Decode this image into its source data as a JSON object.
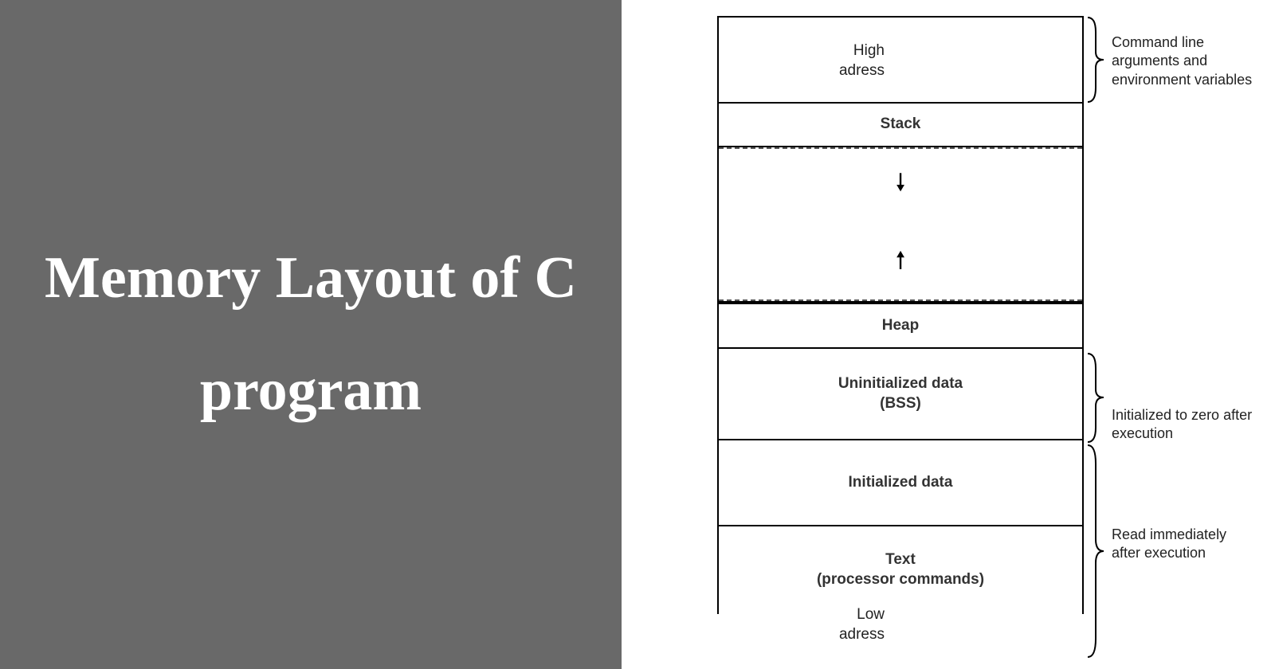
{
  "title": "Memory Layout of C program",
  "left_labels": {
    "high": "High\nadress",
    "low": "Low\nadress"
  },
  "segments": {
    "cmdline": "",
    "stack": "Stack",
    "heap": "Heap",
    "bss_line1": "Uninitialized data",
    "bss_line2": "(BSS)",
    "init": "Initialized data",
    "text_line1": "Text",
    "text_line2": "(processor commands)"
  },
  "annotations": {
    "cmdline": "Command line arguments and environment variables",
    "bss": "Initialized to zero after execution",
    "init_text": "Read immediately after execution"
  }
}
